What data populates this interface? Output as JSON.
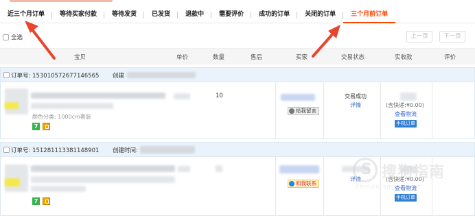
{
  "tabs": [
    {
      "label": "近三个月订单"
    },
    {
      "label": "等待买家付款"
    },
    {
      "label": "等待发货"
    },
    {
      "label": "已发货"
    },
    {
      "label": "退款中"
    },
    {
      "label": "需要评价"
    },
    {
      "label": "成功的订单"
    },
    {
      "label": "关闭的订单"
    },
    {
      "label": "三个月前订单"
    }
  ],
  "toolbar": {
    "select_all": "全选",
    "prev": "上一页",
    "next": "下一页"
  },
  "columns": {
    "item": "宝贝",
    "price": "单价",
    "qty": "数量",
    "after": "售后",
    "buyer": "买家",
    "status": "交易状态",
    "paid": "实收款",
    "review": "评价"
  },
  "orders": [
    {
      "order_no": "订单号: 153010572677146565",
      "created": "创建",
      "spec": "颜色分类: 1000cm套装",
      "qty": "10",
      "buyer_action": "给我留言",
      "status": "交易成功",
      "detail": "详情",
      "paid_prefix": "(含快递:¥0.00)",
      "logistics": "查看物流",
      "mobile": "手机订单"
    },
    {
      "order_no": "订单号: 151281113381148901",
      "created": "创建时间:",
      "buyer_action": "和我联系",
      "detail": "详情",
      "paid_prefix": "(含快递:¥0.00)",
      "logistics": "查看物流",
      "mobile": "手机订单"
    }
  ],
  "badges": {
    "seven_day": "7"
  },
  "watermark": {
    "text": "搜狗指南",
    "sub": "zhinan.sogou.com"
  },
  "colors": {
    "accent": "#ff4400",
    "link": "#3366cc",
    "order_head": "#eaf3fb",
    "arrow": "#e8452f"
  }
}
